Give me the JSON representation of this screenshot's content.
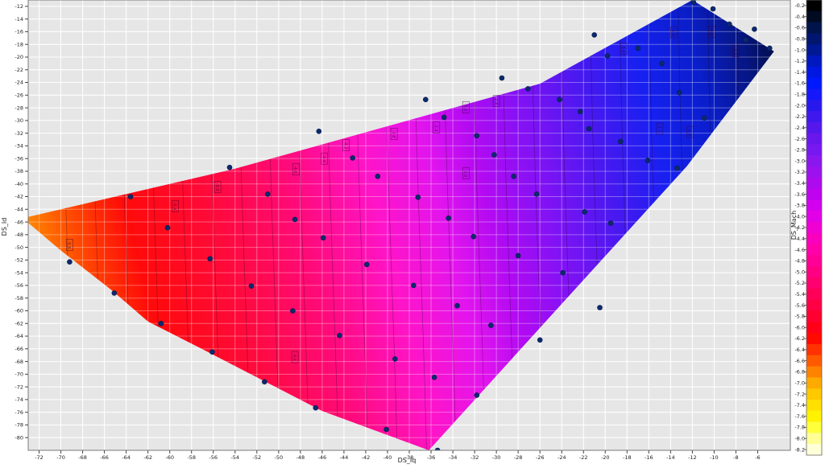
{
  "chart_data": {
    "type": "heatmap",
    "title": "",
    "xlabel": "DS_Iq",
    "ylabel": "DS_Id",
    "zlabel": "DS_Mach",
    "xlim": [
      -73,
      -3
    ],
    "ylim": [
      -82,
      -11
    ],
    "zlim": [
      -8.3,
      -0.1
    ],
    "grid": true,
    "x_ticks": [
      "-72",
      "-70",
      "-68",
      "-66",
      "-64",
      "-62",
      "-60",
      "-58",
      "-56",
      "-54",
      "-52",
      "-50",
      "-48",
      "-46",
      "-44",
      "-42",
      "-40",
      "-38",
      "-36",
      "-34",
      "-32",
      "-30",
      "-28",
      "-26",
      "-24",
      "-22",
      "-20",
      "-18",
      "-16",
      "-14",
      "-12",
      "-10",
      "-8",
      "-6"
    ],
    "y_ticks": [
      "-12",
      "-14",
      "-16",
      "-18",
      "-20",
      "-22",
      "-24",
      "-26",
      "-28",
      "-30",
      "-32",
      "-34",
      "-36",
      "-38",
      "-40",
      "-42",
      "-44",
      "-46",
      "-48",
      "-50",
      "-52",
      "-54",
      "-56",
      "-58",
      "-60",
      "-62",
      "-64",
      "-66",
      "-68",
      "-70",
      "-72",
      "-74",
      "-76",
      "-78",
      "-80"
    ],
    "colorbar_ticks": [
      "-0.2",
      "-0.4",
      "-0.6",
      "-0.8",
      "-1.0",
      "-1.2",
      "-1.4",
      "-1.6",
      "-1.8",
      "-2.0",
      "-2.2",
      "-2.4",
      "-2.6",
      "-2.8",
      "-3.0",
      "-3.2",
      "-3.4",
      "-3.6",
      "-3.8",
      "-4.0",
      "-4.2",
      "-4.4",
      "-4.6",
      "-4.8",
      "-5.0",
      "-5.2",
      "-5.4",
      "-5.6",
      "-5.8",
      "-6.0",
      "-6.2",
      "-6.4",
      "-6.6",
      "-6.8",
      "-7.0",
      "-7.2",
      "-7.4",
      "-7.6",
      "-7.8",
      "-8.0",
      "-8.2"
    ],
    "colorbar_colors": [
      "#000000",
      "#000b22",
      "#00134a",
      "#00166f",
      "#001893",
      "#0018bf",
      "#0018e2",
      "#0018fb",
      "#1518f8",
      "#2818ee",
      "#3e18ec",
      "#5418ec",
      "#6818ec",
      "#7818f0",
      "#8a18ee",
      "#9c12ee",
      "#ae0aee",
      "#bf03ee",
      "#d200ee",
      "#e200e6",
      "#f000d2",
      "#fa00be",
      "#ff00aa",
      "#ff0096",
      "#ff0082",
      "#ff006e",
      "#ff0058",
      "#ff0044",
      "#ff0030",
      "#ff0018",
      "#ff0a00",
      "#ff3200",
      "#ff5a00",
      "#ff8200",
      "#ffaa00",
      "#ffc800",
      "#ffe000",
      "#fff200",
      "#ffff3c",
      "#ffff96",
      "#ffffd8"
    ],
    "region_polygon": [
      [
        -73.5,
        -45.4
      ],
      [
        -54,
        -37.6
      ],
      [
        -26,
        -24.2
      ],
      [
        -12,
        -11.0
      ],
      [
        -4.5,
        -19.1
      ],
      [
        -12.5,
        -37.2
      ],
      [
        -26.8,
        -64.2
      ],
      [
        -36.2,
        -82.0
      ],
      [
        -46,
        -75.8
      ],
      [
        -56.5,
        -66.5
      ],
      [
        -62,
        -61.7
      ],
      [
        -65.3,
        -56.8
      ],
      [
        -70,
        -50.5
      ],
      [
        -73.5,
        -45.4
      ]
    ],
    "contour_labels": [
      {
        "x": -69.2,
        "y": -49.6,
        "value": "-5.8"
      },
      {
        "x": -59.5,
        "y": -43.5,
        "value": "-5.4"
      },
      {
        "x": -55.6,
        "y": -40.5,
        "value": "-5.0"
      },
      {
        "x": -48.4,
        "y": -37.7,
        "value": "-4.6"
      },
      {
        "x": -45.8,
        "y": -36.0,
        "value": "-4.4"
      },
      {
        "x": -43.8,
        "y": -33.9,
        "value": "-4.2"
      },
      {
        "x": -39.4,
        "y": -32.1,
        "value": "-3.8"
      },
      {
        "x": -35.5,
        "y": -31.1,
        "value": "-3.4"
      },
      {
        "x": -32.8,
        "y": -27.9,
        "value": "-3.0"
      },
      {
        "x": -30.0,
        "y": -26.9,
        "value": "-2.8"
      },
      {
        "x": -32.8,
        "y": -38.3,
        "value": "-3.0"
      },
      {
        "x": -48.5,
        "y": -67.3,
        "value": "-4.6"
      },
      {
        "x": -13.7,
        "y": -16.1,
        "value": "-1.0"
      },
      {
        "x": -10.2,
        "y": -16.0,
        "value": "-0.8"
      },
      {
        "x": -8.0,
        "y": -19.1,
        "value": "-0.6"
      },
      {
        "x": -18.3,
        "y": -18.7,
        "value": "-1.4"
      },
      {
        "x": -15.0,
        "y": -31.3,
        "value": "-1.2"
      },
      {
        "x": -12.2,
        "y": -31.8,
        "value": "-1.0"
      }
    ],
    "points": [
      {
        "x": -73.5,
        "y": -45.4
      },
      {
        "x": -69.2,
        "y": -52.3
      },
      {
        "x": -65.1,
        "y": -57.2
      },
      {
        "x": -63.6,
        "y": -42.0
      },
      {
        "x": -60.2,
        "y": -46.9
      },
      {
        "x": -60.8,
        "y": -62.0
      },
      {
        "x": -56.3,
        "y": -51.8
      },
      {
        "x": -56.1,
        "y": -66.5
      },
      {
        "x": -54.5,
        "y": -37.4
      },
      {
        "x": -52.5,
        "y": -56.1
      },
      {
        "x": -51.0,
        "y": -41.6
      },
      {
        "x": -51.3,
        "y": -71.2
      },
      {
        "x": -48.5,
        "y": -45.6
      },
      {
        "x": -48.7,
        "y": -60.0
      },
      {
        "x": -46.3,
        "y": -31.7
      },
      {
        "x": -46.6,
        "y": -75.3
      },
      {
        "x": -45.9,
        "y": -48.5
      },
      {
        "x": -44.4,
        "y": -63.9
      },
      {
        "x": -43.2,
        "y": -35.9
      },
      {
        "x": -41.9,
        "y": -52.7
      },
      {
        "x": -40.9,
        "y": -38.8
      },
      {
        "x": -40.1,
        "y": -78.7
      },
      {
        "x": -39.3,
        "y": -67.6
      },
      {
        "x": -37.6,
        "y": -56.0
      },
      {
        "x": -37.2,
        "y": -42.1
      },
      {
        "x": -36.5,
        "y": -26.7
      },
      {
        "x": -35.7,
        "y": -70.5
      },
      {
        "x": -35.4,
        "y": -82.0
      },
      {
        "x": -34.8,
        "y": -29.5
      },
      {
        "x": -34.4,
        "y": -45.4
      },
      {
        "x": -33.6,
        "y": -59.2
      },
      {
        "x": -31.8,
        "y": -32.4
      },
      {
        "x": -32.1,
        "y": -48.3
      },
      {
        "x": -31.8,
        "y": -73.3
      },
      {
        "x": -30.2,
        "y": -35.4
      },
      {
        "x": -30.5,
        "y": -62.3
      },
      {
        "x": -29.5,
        "y": -23.3
      },
      {
        "x": -28.4,
        "y": -38.8
      },
      {
        "x": -28.0,
        "y": -51.3
      },
      {
        "x": -27.1,
        "y": -25.0
      },
      {
        "x": -26.3,
        "y": -41.6
      },
      {
        "x": -26.0,
        "y": -64.6
      },
      {
        "x": -24.2,
        "y": -26.7
      },
      {
        "x": -23.9,
        "y": -54.0
      },
      {
        "x": -22.3,
        "y": -28.6
      },
      {
        "x": -21.9,
        "y": -44.4
      },
      {
        "x": -21.0,
        "y": -16.5
      },
      {
        "x": -21.5,
        "y": -31.3
      },
      {
        "x": -20.5,
        "y": -59.5
      },
      {
        "x": -19.8,
        "y": -19.8
      },
      {
        "x": -19.5,
        "y": -46.2
      },
      {
        "x": -18.6,
        "y": -33.3
      },
      {
        "x": -17.0,
        "y": -18.6
      },
      {
        "x": -16.1,
        "y": -36.3
      },
      {
        "x": -14.8,
        "y": -21.0
      },
      {
        "x": -13.2,
        "y": -25.6
      },
      {
        "x": -13.4,
        "y": -37.5
      },
      {
        "x": -11.9,
        "y": -11.3
      },
      {
        "x": -10.1,
        "y": -12.4
      },
      {
        "x": -8.6,
        "y": -14.8
      },
      {
        "x": -6.3,
        "y": -15.6
      },
      {
        "x": -7.1,
        "y": -17.3
      },
      {
        "x": -4.9,
        "y": -18.6
      },
      {
        "x": -10.9,
        "y": -29.6
      }
    ]
  }
}
